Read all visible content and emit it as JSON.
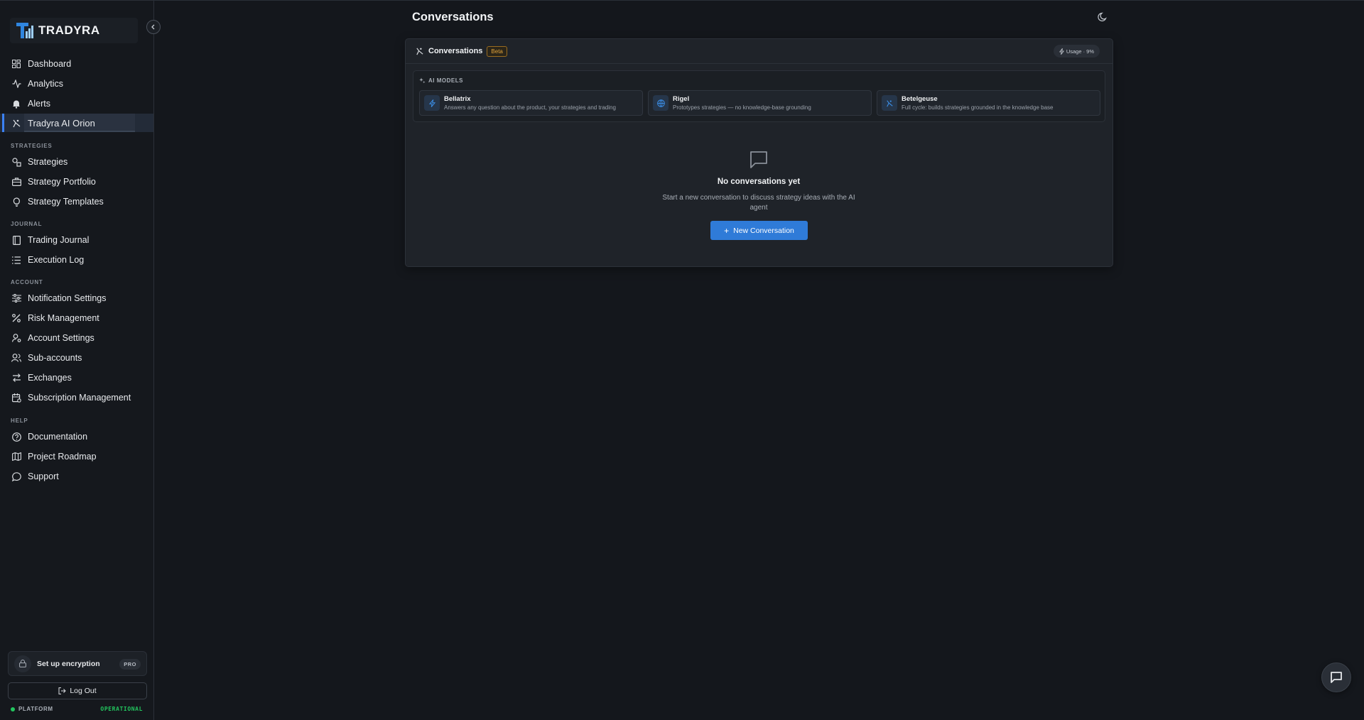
{
  "brand": {
    "name": "TRADYRA"
  },
  "sidebar": {
    "main": [
      {
        "label": "Dashboard",
        "icon": "dashboard-icon"
      },
      {
        "label": "Analytics",
        "icon": "activity-icon"
      },
      {
        "label": "Alerts",
        "icon": "bell-icon"
      },
      {
        "label": "Tradyra AI Orion",
        "icon": "orion-icon",
        "active": true
      }
    ],
    "sections": {
      "strategies": "STRATEGIES",
      "journal": "JOURNAL",
      "account": "ACCOUNT",
      "help": "HELP"
    },
    "strategies": [
      {
        "label": "Strategies",
        "icon": "shapes-icon"
      },
      {
        "label": "Strategy Portfolio",
        "icon": "briefcase-icon"
      },
      {
        "label": "Strategy Templates",
        "icon": "lightbulb-icon"
      }
    ],
    "journal": [
      {
        "label": "Trading Journal",
        "icon": "book-icon"
      },
      {
        "label": "Execution Log",
        "icon": "list-icon"
      }
    ],
    "account": [
      {
        "label": "Notification Settings",
        "icon": "sliders-icon"
      },
      {
        "label": "Risk Management",
        "icon": "percent-icon"
      },
      {
        "label": "Account Settings",
        "icon": "user-cog-icon"
      },
      {
        "label": "Sub-accounts",
        "icon": "users-icon"
      },
      {
        "label": "Exchanges",
        "icon": "arrows-exchange-icon"
      },
      {
        "label": "Subscription Management",
        "icon": "calendar-cog-icon"
      }
    ],
    "help": [
      {
        "label": "Documentation",
        "icon": "help-circle-icon"
      },
      {
        "label": "Project Roadmap",
        "icon": "map-icon"
      },
      {
        "label": "Support",
        "icon": "message-circle-icon"
      }
    ],
    "encryption": {
      "label": "Set up encryption",
      "badge": "PRO"
    },
    "logout": "Log Out",
    "status": {
      "left": "PLATFORM",
      "right": "OPERATIONAL"
    }
  },
  "header": {
    "title": "Conversations"
  },
  "card": {
    "title": "Conversations",
    "badge": "Beta",
    "usage": "Usage · 9%",
    "models_label": "AI MODELS",
    "models": [
      {
        "name": "Bellatrix",
        "desc": "Answers any question about the product, your strategies and trading"
      },
      {
        "name": "Rigel",
        "desc": "Prototypes strategies — no knowledge-base grounding"
      },
      {
        "name": "Betelgeuse",
        "desc": "Full cycle: builds strategies grounded in the knowledge base"
      }
    ],
    "empty": {
      "title": "No conversations yet",
      "desc": "Start a new conversation to discuss strategy ideas with the AI agent"
    },
    "new_button": "New Conversation"
  },
  "colors": {
    "accent": "#2f7bd8",
    "beta": "#e0a23a",
    "operational": "#22c55e"
  }
}
